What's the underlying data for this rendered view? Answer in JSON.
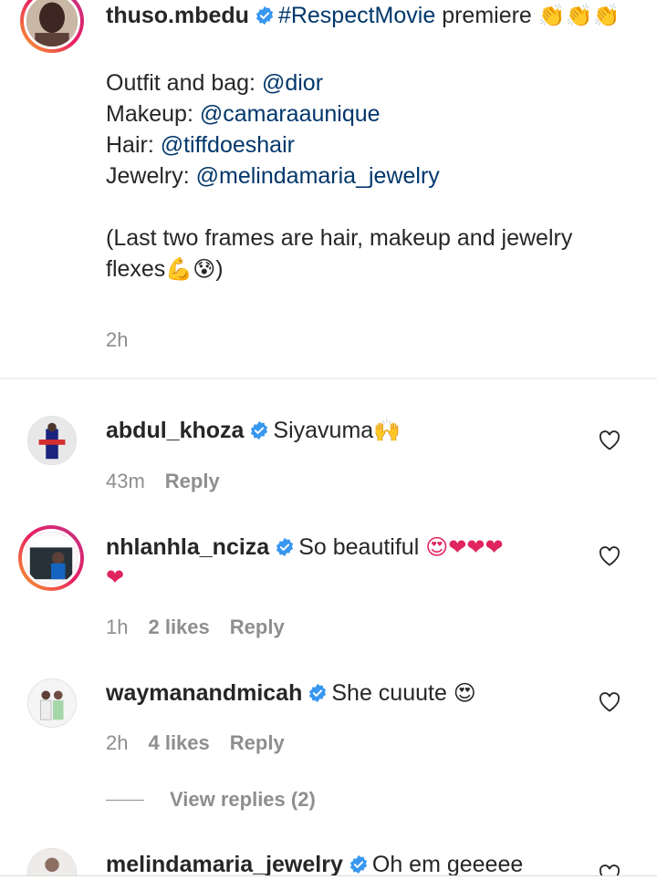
{
  "caption": {
    "username": "thuso.mbedu",
    "hashtag": "#RespectMovie",
    "text_after_hashtag": " premiere ",
    "clap_emoji": "👏👏👏",
    "outfit_label": "Outfit and bag: ",
    "outfit_handle": "@dior",
    "makeup_label": "Makeup: ",
    "makeup_handle": "@camaraaunique",
    "hair_label": "Hair: ",
    "hair_handle": "@tiffdoeshair",
    "jewelry_label": "Jewelry: ",
    "jewelry_handle": "@melindamaria_jewelry",
    "note_line1": "(Last two frames are hair, makeup and jewelry",
    "note_line2": "flexes",
    "note_emoji": "💪😰",
    "note_close": ")",
    "time": "2h"
  },
  "comments": [
    {
      "username": "abdul_khoza",
      "text": "Siyavuma",
      "emoji": "🙌",
      "time": "43m",
      "likes": "",
      "reply_label": "Reply"
    },
    {
      "username": "nhlanhla_nciza",
      "text": "So beautiful ",
      "emoji": "😍❤❤❤",
      "emoji_line2": "❤",
      "time": "1h",
      "likes": "2 likes",
      "reply_label": "Reply"
    },
    {
      "username": "waymanandmicah",
      "text": "She cuuute ",
      "emoji": "😍",
      "time": "2h",
      "likes": "4 likes",
      "reply_label": "Reply"
    },
    {
      "username": "melindamaria_jewelry",
      "text": "Oh em geeeee"
    }
  ],
  "view_replies": "View replies (2)",
  "icons": {
    "verified": "verified-badge-icon",
    "heart": "heart-outline-icon"
  },
  "colors": {
    "link": "#00376b",
    "verified": "#3897f0",
    "muted": "#8e8e8e"
  }
}
